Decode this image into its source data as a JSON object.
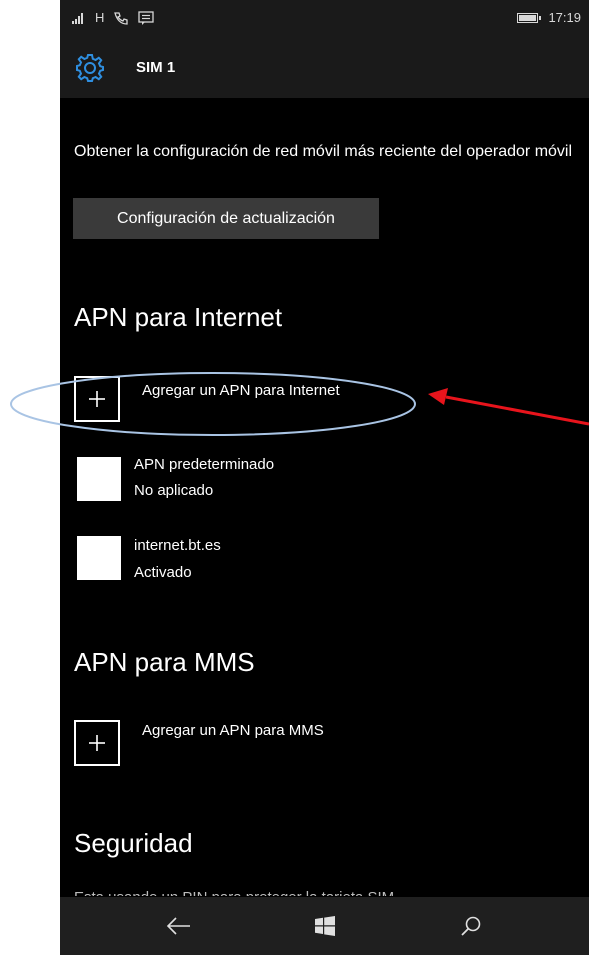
{
  "statusbar": {
    "left_icons": [
      "signal-icon",
      "network-type",
      "missed-call-icon",
      "message-icon"
    ],
    "network_type": "H",
    "time": "17:19",
    "battery_level": 0.95
  },
  "header": {
    "icon": "gear-icon",
    "title": "SIM 1"
  },
  "main": {
    "description": "Obtener la configuración de red móvil más reciente del operador móvil",
    "update_button": "Configuración de actualización",
    "internet_section": {
      "heading": "APN para Internet",
      "add_label": "Agregar un APN para Internet",
      "items": [
        {
          "title": "APN predeterminado",
          "status": "No aplicado"
        },
        {
          "title": "internet.bt.es",
          "status": "Activado"
        }
      ]
    },
    "mms_section": {
      "heading": "APN para MMS",
      "add_label": "Agregar un APN para MMS"
    },
    "security_section": {
      "heading": "Seguridad",
      "cutoff_text": "Esta usando un PIN para proteger la tarjeta SIM"
    }
  },
  "navbar": {
    "buttons": [
      "back-arrow-icon",
      "windows-logo-icon",
      "search-icon"
    ]
  },
  "annotation": {
    "highlight_color": "#a9c4e4",
    "arrow_color": "#e8141c"
  }
}
